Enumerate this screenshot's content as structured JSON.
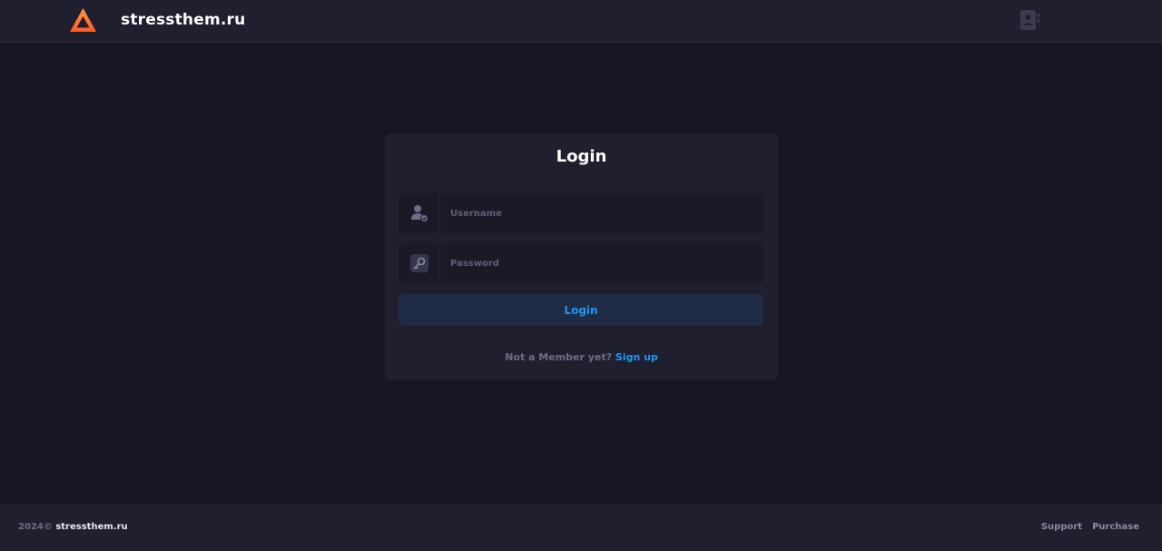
{
  "header": {
    "brand": "stressthem.ru",
    "logo_icon": "triangle-logo-icon",
    "profile_icon": "user-card-icon"
  },
  "login": {
    "title": "Login",
    "username_placeholder": "Username",
    "password_placeholder": "Password",
    "submit_label": "Login",
    "signup_prompt": "Not a Member yet?",
    "signup_link": "Sign up"
  },
  "footer": {
    "year": "2024©",
    "brand": "stressthem.ru",
    "links": [
      "Support",
      "Purchase"
    ]
  },
  "colors": {
    "background": "#161622",
    "panel": "#1f1f2d",
    "accent": "#2196f3",
    "logo_orange": "#ff7a2f",
    "muted_text": "#6c6d88"
  }
}
